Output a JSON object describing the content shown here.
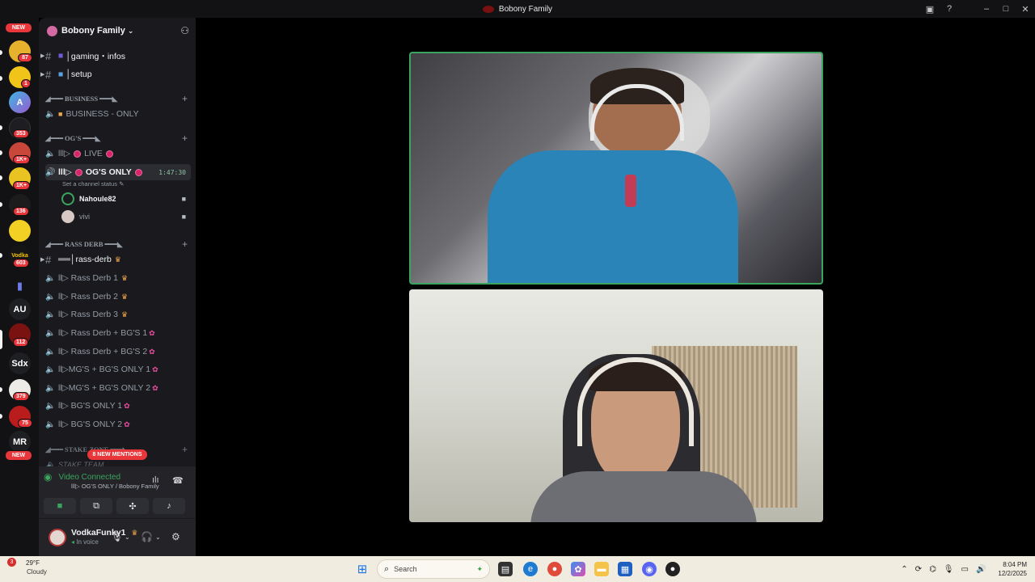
{
  "window": {
    "title": "Bobony Family"
  },
  "server": {
    "name": "Bobony Family"
  },
  "servers": [
    {
      "badge": "NEW",
      "label": ""
    },
    {
      "badge": "87",
      "label": ""
    },
    {
      "badge": "1",
      "label": ""
    },
    {
      "badge": "",
      "label": "A"
    },
    {
      "badge": "353",
      "label": ""
    },
    {
      "badge": "1K+",
      "label": ""
    },
    {
      "badge": "1K+",
      "label": ""
    },
    {
      "badge": "136",
      "label": ""
    },
    {
      "badge": "",
      "label": ""
    },
    {
      "badge": "603",
      "label": ""
    },
    {
      "badge": "",
      "label": ""
    },
    {
      "badge": "",
      "label": "AU"
    },
    {
      "badge": "112",
      "label": ""
    },
    {
      "badge": "",
      "label": "Sdx"
    },
    {
      "badge": "379",
      "label": ""
    },
    {
      "badge": "75",
      "label": ""
    },
    {
      "badge": "",
      "label": "MR"
    },
    {
      "badge": "NEW",
      "label": ""
    }
  ],
  "channels": {
    "gaming": "│gaming・infos",
    "setup": "│setup",
    "cat_business": "◢━━━ BUSINESS ━━━◣",
    "business_only": "BUSINESS - ONLY",
    "cat_ogs": "◢━━━ OG'S ━━━◣",
    "live": "LIVE",
    "ogs_only": "OG'S ONLY",
    "ogs_only_time": "1:47:30",
    "channel_status": "Set a channel status",
    "prefix_live": "lll▷",
    "prefix_ogs": "lll▷",
    "cat_rass": "◢━━━ RASS DERB ━━━◣",
    "rass_derb": "══│rass-derb",
    "rass1": "ll▷ Rass Derb 1",
    "rass2": "ll▷ Rass Derb 2",
    "rass3": "ll▷ Rass Derb 3",
    "rassbg1": "ll▷ Rass Derb + BG'S 1",
    "rassbg2": "ll▷ Rass Derb + BG'S 2",
    "mgbg1": "ll▷MG'S + BG'S ONLY 1",
    "mgbg2": "ll▷MG'S + BG'S ONLY 2",
    "bg1": "ll▷ BG'S ONLY 1",
    "bg2": "ll▷ BG'S ONLY 2",
    "cat_stake": "◢━━━ STAKE ZONE ━━━◣",
    "stake_team": "STAKE TEAM"
  },
  "voice_users": [
    {
      "name": "Nahoule82"
    },
    {
      "name": "vivi"
    }
  ],
  "mentions": "8 NEW MENTIONS",
  "voice_panel": {
    "state": "Video Connected",
    "channel": "lll▷ OG'S ONLY / Bobony Family"
  },
  "user": {
    "name": "VodkaFunky1",
    "status": "In voice"
  },
  "taskbar": {
    "temp": "29°F",
    "weather": "Cloudy",
    "weather_badge": "3",
    "search_placeholder": "Search",
    "time": "8:04 PM",
    "date": "12/2/2025"
  },
  "colors": {
    "accent_green": "#3ba55d",
    "mention_red": "#e8363a"
  }
}
